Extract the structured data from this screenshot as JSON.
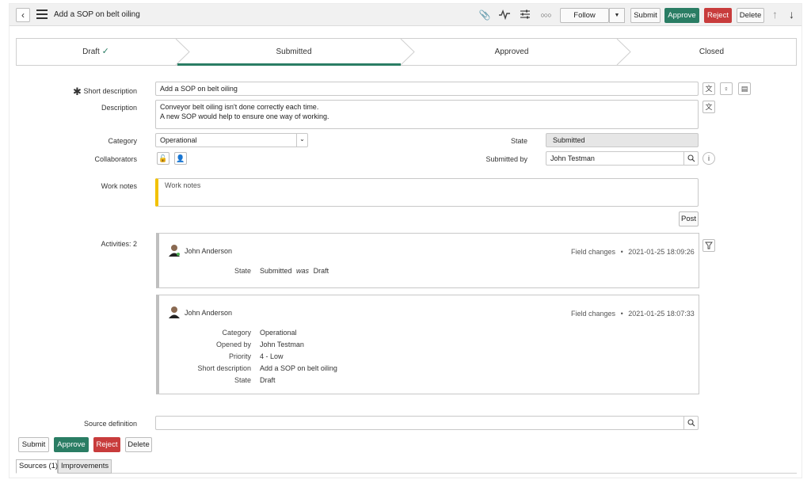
{
  "header": {
    "title": "Add a SOP on belt oiling",
    "follow": "Follow",
    "submit": "Submit",
    "approve": "Approve",
    "reject": "Reject",
    "delete": "Delete"
  },
  "progress": {
    "steps": [
      "Draft",
      "Submitted",
      "Approved",
      "Closed"
    ],
    "active": "Submitted",
    "done_mark": "✓"
  },
  "form": {
    "short_description_label": "Short description",
    "short_description_value": "Add a SOP on belt oiling",
    "description_label": "Description",
    "description_line1": "Conveyor belt oiling isn't done correctly each time.",
    "description_line2": "A new SOP would help to ensure one way of working.",
    "category_label": "Category",
    "category_value": "Operational",
    "state_label": "State",
    "state_value": "Submitted",
    "collaborators_label": "Collaborators",
    "submitted_by_label": "Submitted by",
    "submitted_by_value": "John Testman",
    "work_notes_label": "Work notes",
    "work_notes_placeholder": "Work notes",
    "post": "Post",
    "activities_label": "Activities: 2",
    "source_definition_label": "Source definition"
  },
  "activities": [
    {
      "name": "John Anderson",
      "type": "Field changes",
      "time": "2021-01-25 18:09:26",
      "state_key": "State",
      "state_new": "Submitted",
      "was": "was",
      "state_old": "Draft"
    },
    {
      "name": "John Anderson",
      "type": "Field changes",
      "time": "2021-01-25 18:07:33",
      "fields": [
        {
          "k": "Category",
          "v": "Operational"
        },
        {
          "k": "Opened by",
          "v": "John Testman"
        },
        {
          "k": "Priority",
          "v": "4 - Low"
        },
        {
          "k": "Short description",
          "v": "Add a SOP on belt oiling"
        },
        {
          "k": "State",
          "v": "Draft"
        }
      ]
    }
  ],
  "bottom": {
    "submit": "Submit",
    "approve": "Approve",
    "reject": "Reject",
    "delete": "Delete"
  },
  "tabs": [
    "Sources (1)",
    "Improvements"
  ],
  "colors": {
    "accent": "#2a7d64",
    "reject": "#c83c3c",
    "work_notes_bar": "#f2c200"
  }
}
